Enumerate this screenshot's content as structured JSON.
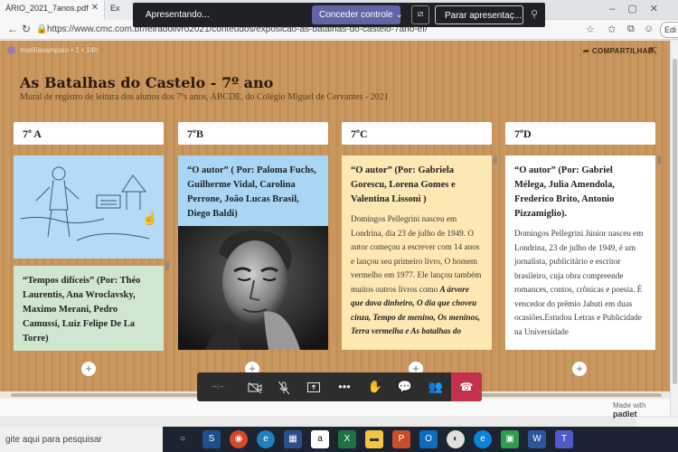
{
  "browser": {
    "tabs": [
      {
        "label": "ÁRIO_2021_7anos.pdf"
      },
      {
        "label": "Ex"
      }
    ],
    "url": "https://www.cmc.com.br/feiradolivro2021/conteudos/exposicao-as-batalhas-do-castelo-7ano-ef/",
    "edit_label": "Edi"
  },
  "presenting": {
    "status": "Apresentando...",
    "grant_label": "Conceder controle",
    "stop_label": "Parar apresentaç..."
  },
  "padlet": {
    "author": "mariliasampaio",
    "likes": "1",
    "time": "14h",
    "share_label": "COMPARTILHAR",
    "title": "As Batalhas do Castelo - 7º ano",
    "subtitle": "Mural de registro de leitura dos alunos dos 7ºs anos, ABCDE, do Colégio Miguel de Cervantes - 2021",
    "columns": [
      {
        "header": "7º A",
        "posts": [
          {
            "title": "",
            "body": ""
          },
          {
            "title": "“Tempos difíceis” (Por: Théo Laurentis, Ana Wroclavsky, Maximo Merani, Pedro Camussi, Luiz Felipe De La Torre)",
            "body": ""
          }
        ]
      },
      {
        "header": "7ºB",
        "posts": [
          {
            "title": "“O autor” ( Por: Paloma Fuchs, Guilherme Vidal, Carolina Perrone, João Lucas Brasil, Diego Baldi)",
            "body": ""
          }
        ]
      },
      {
        "header": "7ºC",
        "posts": [
          {
            "title": "“O autor” (Por: Gabriela Gorescu, Lorena Gomes e Valentina Lissoni )",
            "body_pre": "Domingos Pellegrini nasceu em Londrina, dia 23 de julho de 1949. O autor começou a escrever com 14 anos e lançou seu primeiro livro, O homem vermelho em 1977. Ele lançou também muitos outros livros como ",
            "body_em": "A árvore que dava dinheiro, O dia que choveu cinza, Tempo de menino, Os meninos, Terra vermelha e As batalhas do"
          }
        ]
      },
      {
        "header": "7ºD",
        "posts": [
          {
            "title": "“O autor” (Por: Gabriel Mélega, Julia Amendola, Frederico Brito, Antonio Pizzamiglio).",
            "body": "Domingos Pellegrini Júnior nasceu em Londrina, 23 de julho de 1949, é um jornalista, publicitário e escritor brasileiro, cuja obra compreende romances, contos, crônicas e poesia. É vencedor do prêmio Jabuti em duas ocasiões.Estudou Letras e Publicidade na Universidade"
          }
        ]
      }
    ],
    "made_with": "Made with",
    "brand": "padlet"
  },
  "call": {
    "timer": "--:--"
  },
  "taskbar": {
    "search_placeholder": "gite aqui para pesquisar"
  }
}
